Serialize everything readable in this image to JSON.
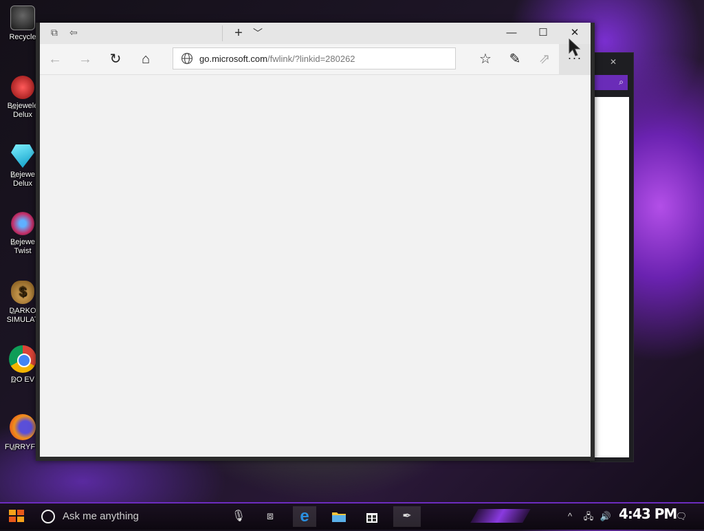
{
  "desktop": {
    "icons": [
      {
        "label": "Recycle",
        "icon": "recycle-bin-icon",
        "color": "#2b2b2b"
      },
      {
        "label": "Bejewele Deluxe",
        "line1": "Bejewele",
        "line2": "Delux",
        "icon": "bejeweled-2-icon",
        "color": "#d32a2a"
      },
      {
        "label": "Bejewe Delux",
        "line1": "Bejewe",
        "line2": "Delux",
        "icon": "bejeweled-gem-icon",
        "color": "#21c6ee"
      },
      {
        "label": "Bejewe Twist",
        "line1": "Bejewe",
        "line2": "Twist",
        "icon": "bejeweled-twist-icon",
        "color": "#c4306a"
      },
      {
        "label": "DARKO SIMULAT",
        "line1": "DARKO",
        "line2": "SIMULAT",
        "icon": "money-bag-icon",
        "color": "#b8893a"
      },
      {
        "label": "DO EV",
        "line1": "DO EV",
        "line2": "",
        "icon": "chrome-icon",
        "color": "#2e9d4a"
      },
      {
        "label": "FURRYFU",
        "line1": "FURRYFU",
        "line2": "",
        "icon": "firefox-icon",
        "color": "#f08a1c"
      }
    ]
  },
  "browser": {
    "url_host": "go.microsoft.com",
    "url_path": "/fwlink/?linkid=280262",
    "window_buttons": {
      "minimize": "—",
      "maximize": "☐",
      "close": "✕"
    },
    "more": "···"
  },
  "taskbar": {
    "search_placeholder": "Ask me anything",
    "clock": "4:43 PM",
    "accent": "#6d2cc0"
  }
}
